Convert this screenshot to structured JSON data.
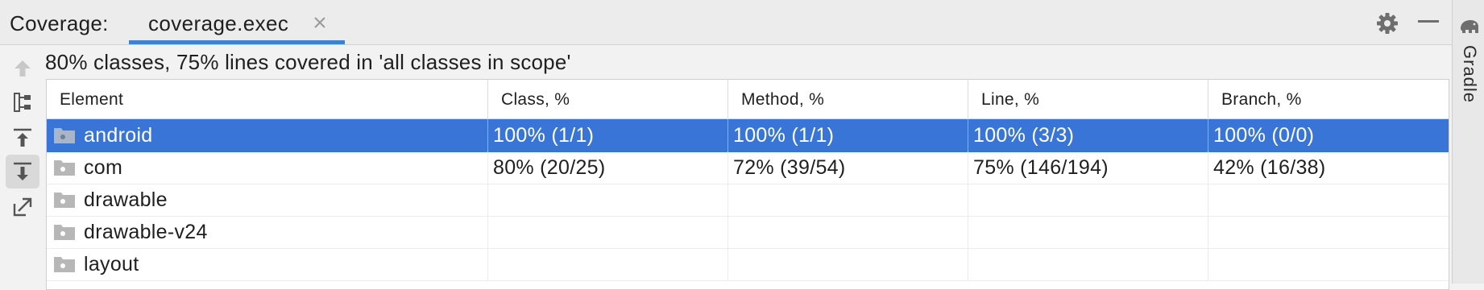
{
  "window": {
    "title_label": "Coverage:"
  },
  "tab": {
    "label": "coverage.exec",
    "close_icon": "close-icon"
  },
  "toolbar_right": {
    "settings_icon": "gear-icon",
    "minimize_icon": "minimize-icon"
  },
  "side_panel": {
    "label": "Gradle",
    "icon": "elephant-icon"
  },
  "left_toolbar": [
    {
      "icon": "arrow-up-icon",
      "active": false
    },
    {
      "icon": "flatten-packages-icon",
      "active": false
    },
    {
      "icon": "import-icon",
      "active": false
    },
    {
      "icon": "export-down-icon",
      "active": true
    },
    {
      "icon": "open-external-icon",
      "active": false
    }
  ],
  "summary": "80% classes, 75% lines covered in 'all classes in scope'",
  "table": {
    "columns": [
      "Element",
      "Class, %",
      "Method, %",
      "Line, %",
      "Branch, %"
    ],
    "rows": [
      {
        "name": "android",
        "selected": true,
        "cells": [
          "100% (1/1)",
          "100% (1/1)",
          "100% (3/3)",
          "100% (0/0)"
        ]
      },
      {
        "name": "com",
        "selected": false,
        "cells": [
          "80% (20/25)",
          "72% (39/54)",
          "75% (146/194)",
          "42% (16/38)"
        ]
      },
      {
        "name": "drawable",
        "selected": false,
        "cells": [
          "",
          "",
          "",
          ""
        ]
      },
      {
        "name": "drawable-v24",
        "selected": false,
        "cells": [
          "",
          "",
          "",
          ""
        ]
      },
      {
        "name": "layout",
        "selected": false,
        "cells": [
          "",
          "",
          "",
          ""
        ]
      }
    ]
  },
  "colors": {
    "accent": "#3b82d6",
    "selection": "#3875d7",
    "background": "#f2f2f2"
  }
}
